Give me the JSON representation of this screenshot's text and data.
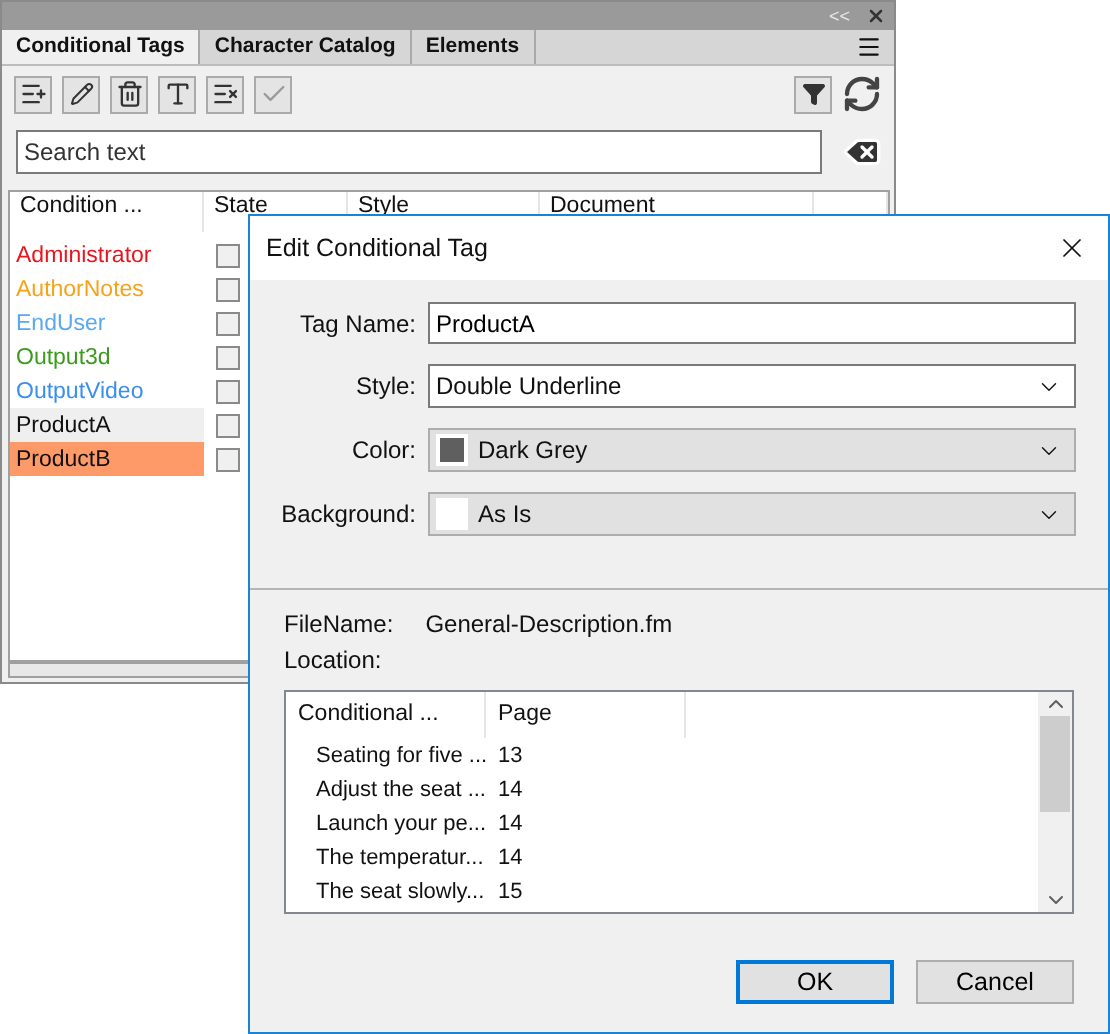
{
  "panel": {
    "collapse_glyph": "<<",
    "tabs": [
      {
        "label": "Conditional Tags",
        "selected": true
      },
      {
        "label": "Character Catalog",
        "selected": false
      },
      {
        "label": "Elements",
        "selected": false
      }
    ],
    "toolbar": [
      {
        "kind": "add",
        "disabled": false
      },
      {
        "kind": "edit",
        "disabled": false
      },
      {
        "kind": "delete",
        "disabled": false
      },
      {
        "kind": "format",
        "disabled": false
      },
      {
        "kind": "remove",
        "disabled": false
      },
      {
        "kind": "apply",
        "disabled": true
      }
    ],
    "search": {
      "placeholder": "Search text"
    },
    "columns": [
      "Condition ...",
      "State",
      "Style",
      "Document"
    ],
    "rows": [
      {
        "name": "Administrator",
        "color": "#e8141e",
        "checked": false,
        "selected": false,
        "hovered": false
      },
      {
        "name": "AuthorNotes",
        "color": "#f7a21b",
        "checked": false,
        "selected": false,
        "hovered": false
      },
      {
        "name": "EndUser",
        "color": "#5aa9f0",
        "checked": false,
        "selected": false,
        "hovered": false
      },
      {
        "name": "Output3d",
        "color": "#3c9a1e",
        "checked": false,
        "selected": false,
        "hovered": false
      },
      {
        "name": "OutputVideo",
        "color": "#3a8ef0",
        "checked": false,
        "selected": false,
        "hovered": false
      },
      {
        "name": "ProductA",
        "color": "#111111",
        "checked": false,
        "selected": false,
        "hovered": true
      },
      {
        "name": "ProductB",
        "color": "#111111",
        "checked": false,
        "selected": true,
        "hovered": false
      }
    ]
  },
  "dialog": {
    "title": "Edit Conditional Tag",
    "fields": [
      {
        "label": "Tag Name:",
        "kind": "text",
        "value": "ProductA"
      },
      {
        "label": "Style:",
        "kind": "select",
        "value": "Double Underline"
      },
      {
        "label": "Color:",
        "kind": "swatch",
        "value": "Dark Grey",
        "color": "#5f5f5f"
      },
      {
        "label": "Background:",
        "kind": "swatch",
        "value": "As Is",
        "color": "#ffffff"
      }
    ],
    "file_name": {
      "label": "FileName:",
      "value": "General-Description.fm"
    },
    "location_label": "Location:",
    "location_columns": [
      "Conditional ...",
      "Page"
    ],
    "location_rows": [
      {
        "text": "Seating for five ...",
        "page": "13"
      },
      {
        "text": "Adjust the seat ...",
        "page": "14"
      },
      {
        "text": "Launch your pe...",
        "page": "14"
      },
      {
        "text": "The temperatur...",
        "page": "14"
      },
      {
        "text": "The seat slowly...",
        "page": "15"
      }
    ],
    "buttons": [
      {
        "label": "OK",
        "default": true
      },
      {
        "label": "Cancel",
        "default": false
      }
    ]
  }
}
